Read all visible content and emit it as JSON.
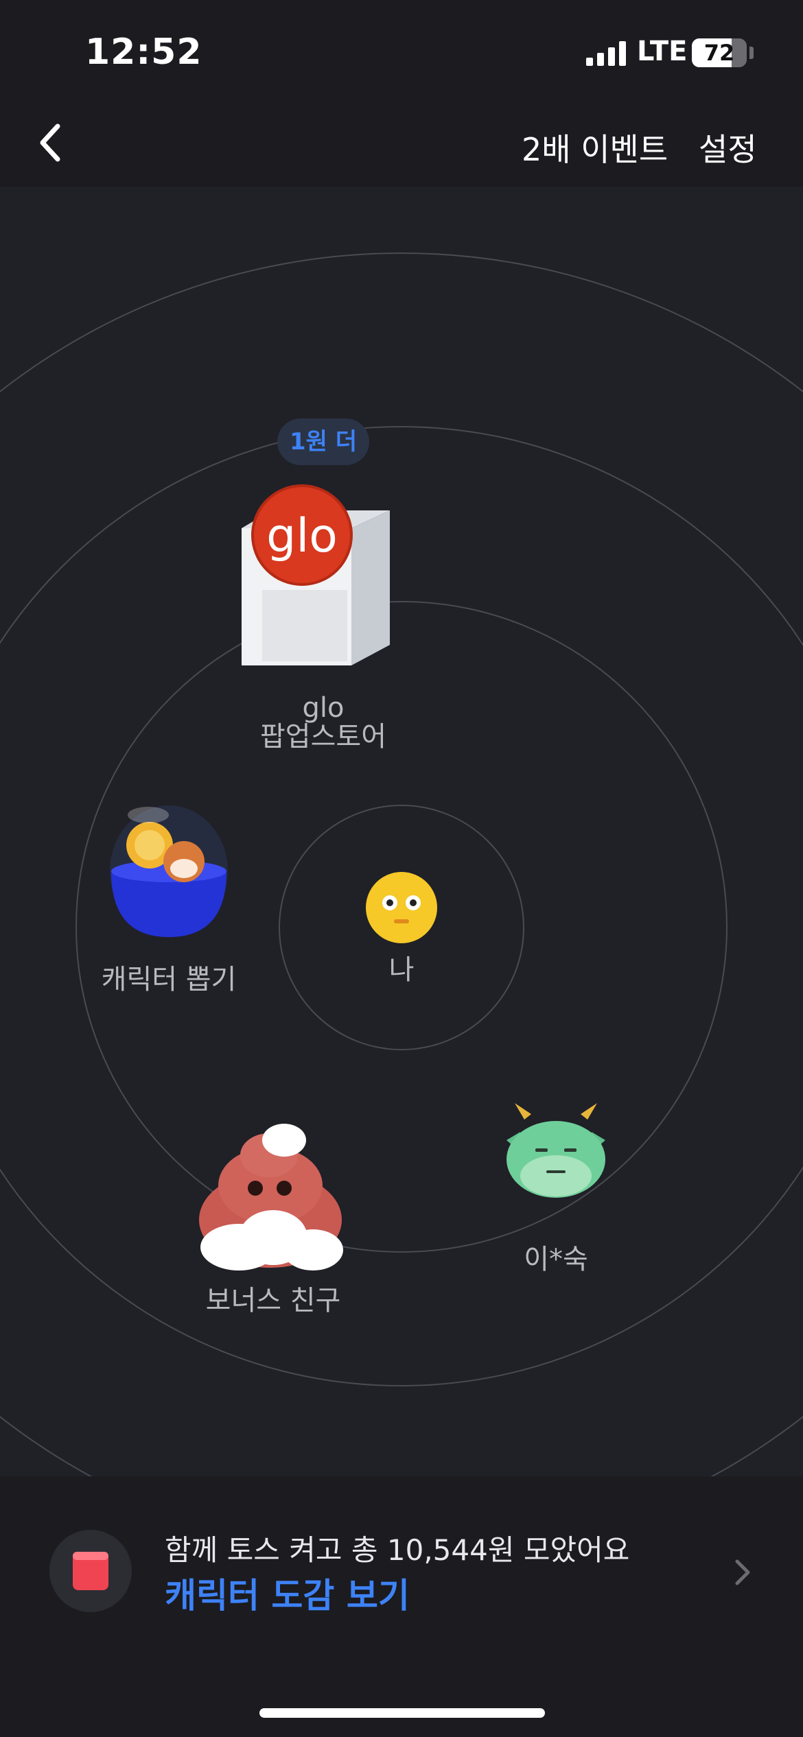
{
  "status": {
    "time": "12:52",
    "network": "LTE",
    "battery": "72",
    "battery_level": 0.72
  },
  "nav": {
    "event_label": "2배 이벤트",
    "settings_label": "설정"
  },
  "map": {
    "badge": "1원 더",
    "nodes": {
      "glo_line1": "glo",
      "glo_line2": "팝업스토어",
      "me": "나",
      "gacha": "캐릭터 뽑기",
      "bonus": "보너스 친구",
      "friend": "이*숙"
    }
  },
  "bottom": {
    "summary": "함께 토스 켜고 총 10,544원 모았어요",
    "link": "캐릭터 도감 보기"
  },
  "colors": {
    "accent": "#3e82f7",
    "background": "#202027",
    "bar": "#1b1b20"
  }
}
